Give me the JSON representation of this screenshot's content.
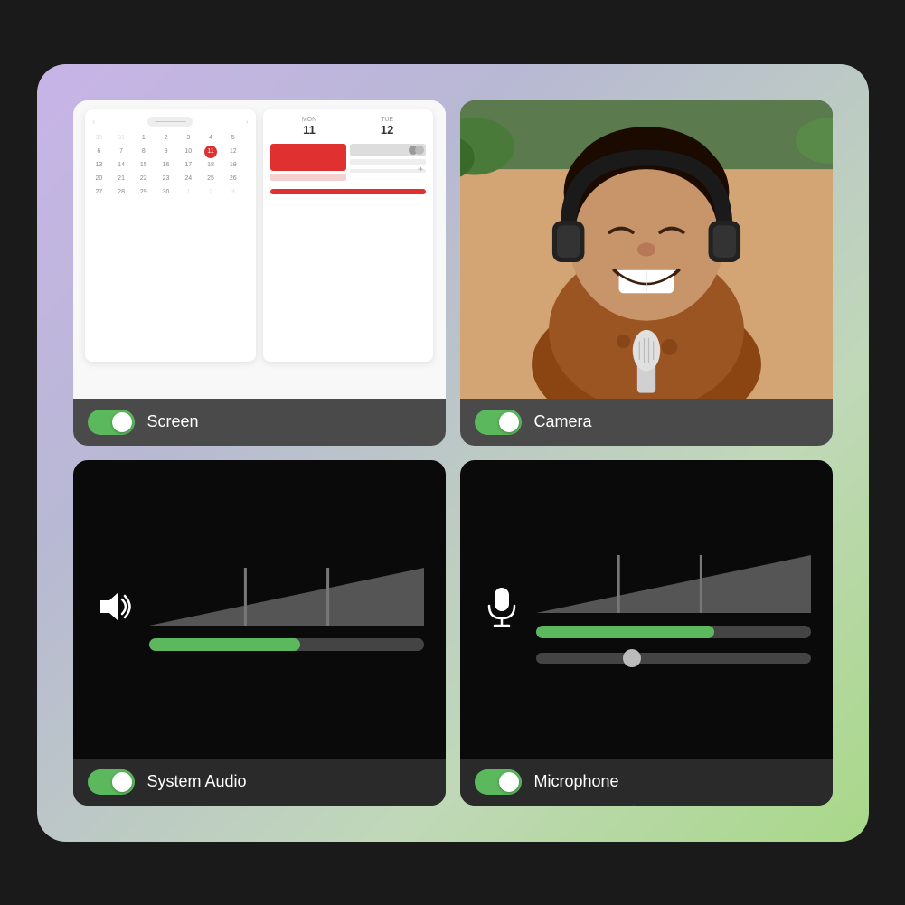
{
  "background": {
    "gradient_start": "#c8b4e8",
    "gradient_end": "#a8d888"
  },
  "cards": {
    "screen": {
      "label": "Screen",
      "toggle_on": true
    },
    "camera": {
      "label": "Camera",
      "toggle_on": true
    },
    "system_audio": {
      "label": "System Audio",
      "toggle_on": true,
      "volume_pct": 55
    },
    "microphone": {
      "label": "Microphone",
      "toggle_on": true,
      "volume_pct": 65,
      "slider_pct": 35
    }
  },
  "calendar": {
    "days": [
      "30",
      "31",
      "1",
      "2",
      "3",
      "4",
      "5",
      "6",
      "7",
      "8",
      "9",
      "10",
      "11",
      "12",
      "13",
      "14",
      "15",
      "16",
      "17",
      "18",
      "19",
      "20",
      "21",
      "22",
      "23",
      "24",
      "25",
      "26",
      "27",
      "28",
      "29",
      "30",
      "1",
      "2",
      "3"
    ],
    "today": 11
  },
  "schedule": {
    "day1_num": "11",
    "day1_label": "MON",
    "day2_num": "12",
    "day2_label": "TUE"
  }
}
